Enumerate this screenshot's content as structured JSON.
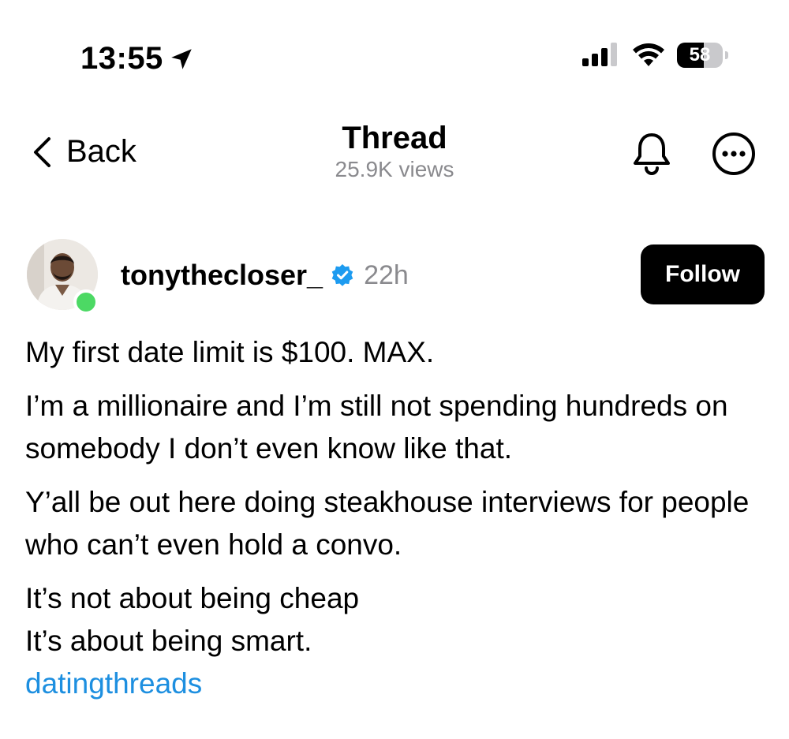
{
  "status_bar": {
    "time": "13:55",
    "battery": "58",
    "battery_level": 0.58
  },
  "nav": {
    "back_label": "Back",
    "title": "Thread",
    "subtitle": "25.9K views"
  },
  "post": {
    "username": "tonythecloser_",
    "time": "22h",
    "follow_label": "Follow",
    "paragraphs": [
      "My first date limit is $100. MAX.",
      "I’m a millionaire and I’m still not spending hundreds on somebody I don’t even know like that.",
      "Y’all be out here doing steakhouse interviews for people who can’t even hold a convo.",
      "It’s not about being cheap",
      "It’s about being smart."
    ],
    "tag": "datingthreads"
  },
  "colors": {
    "link": "#1d8fe0",
    "verified": "#1d9bf0",
    "online": "#4cd964",
    "secondary_text": "#8a8a8e"
  }
}
